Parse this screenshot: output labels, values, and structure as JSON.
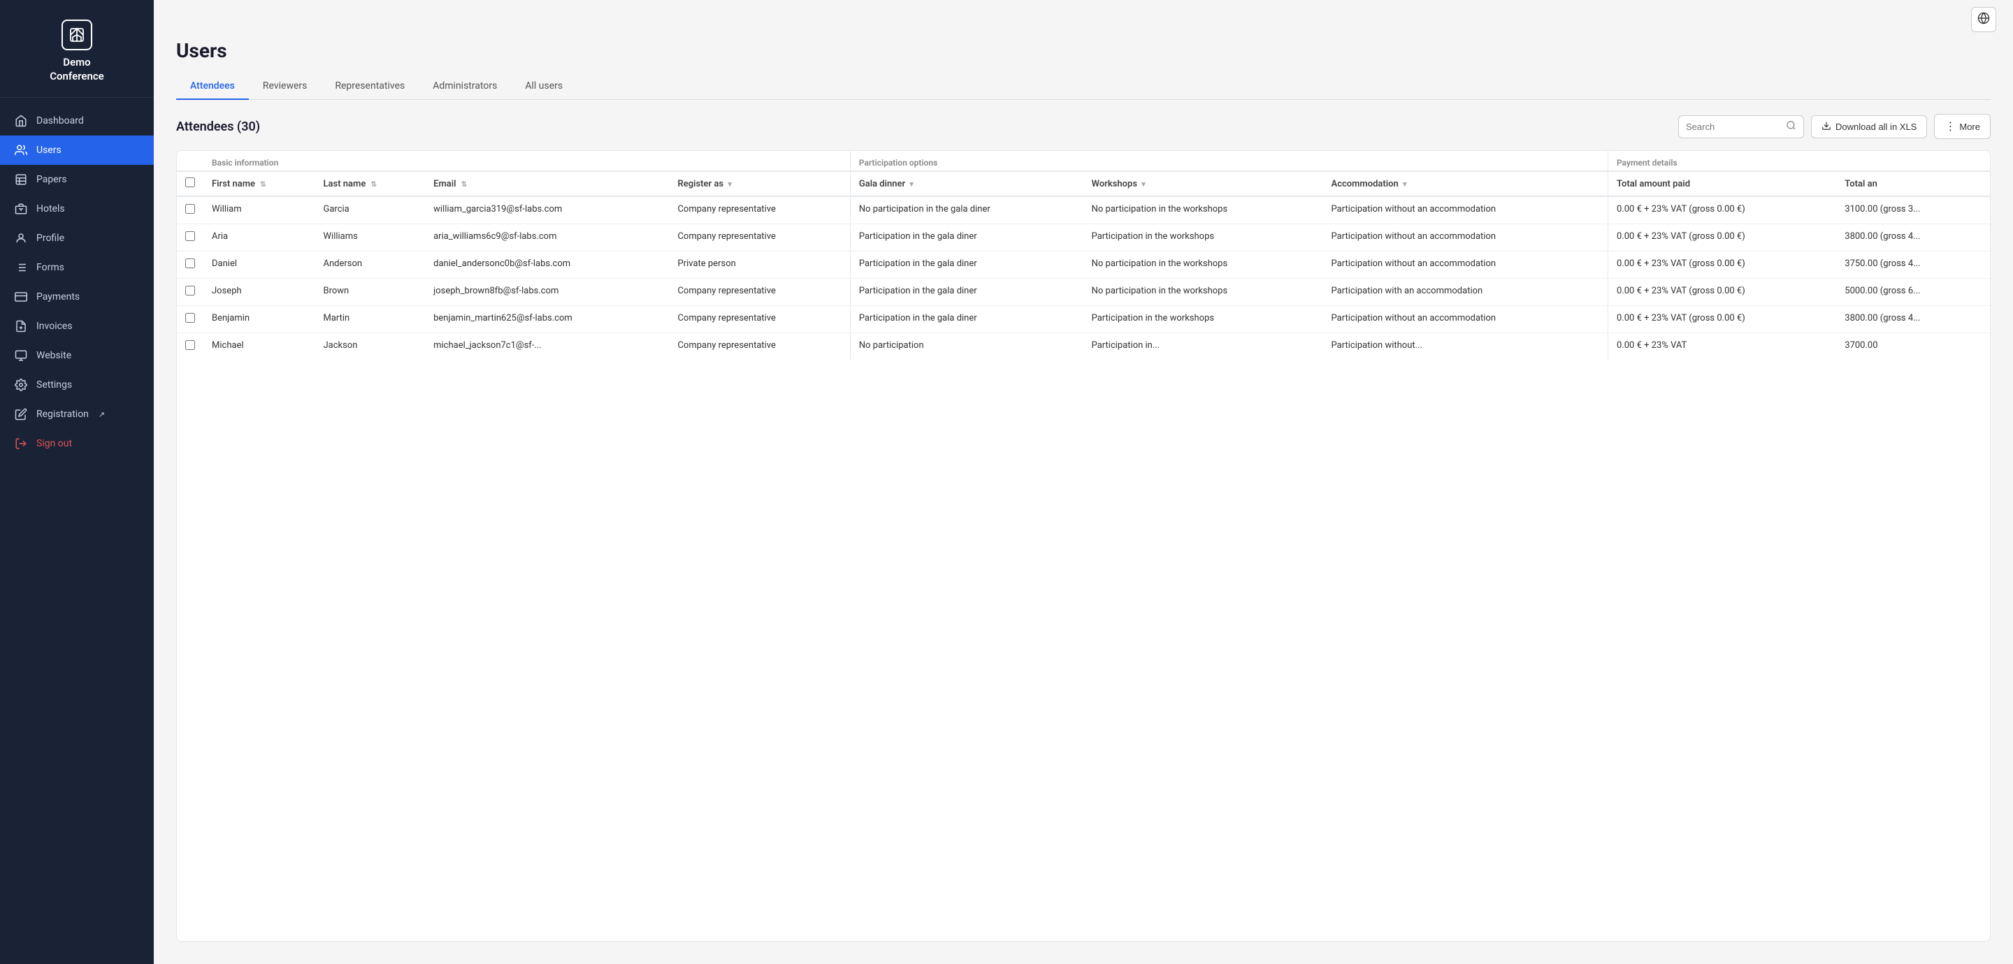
{
  "sidebar": {
    "logo": {
      "title": "Demo\nConference"
    },
    "nav_items": [
      {
        "id": "dashboard",
        "label": "Dashboard",
        "icon": "home-icon",
        "active": false
      },
      {
        "id": "users",
        "label": "Users",
        "icon": "users-icon",
        "active": true
      },
      {
        "id": "papers",
        "label": "Papers",
        "icon": "papers-icon",
        "active": false
      },
      {
        "id": "hotels",
        "label": "Hotels",
        "icon": "hotels-icon",
        "active": false
      },
      {
        "id": "profile",
        "label": "Profile",
        "icon": "profile-icon",
        "active": false
      },
      {
        "id": "forms",
        "label": "Forms",
        "icon": "forms-icon",
        "active": false
      },
      {
        "id": "payments",
        "label": "Payments",
        "icon": "payments-icon",
        "active": false
      },
      {
        "id": "invoices",
        "label": "Invoices",
        "icon": "invoices-icon",
        "active": false
      },
      {
        "id": "website",
        "label": "Website",
        "icon": "website-icon",
        "active": false
      },
      {
        "id": "settings",
        "label": "Settings",
        "icon": "settings-icon",
        "active": false
      },
      {
        "id": "registration",
        "label": "Registration",
        "icon": "registration-icon",
        "active": false
      }
    ],
    "sign_out_label": "Sign out"
  },
  "page": {
    "title": "Users",
    "tabs": [
      {
        "id": "attendees",
        "label": "Attendees",
        "active": true
      },
      {
        "id": "reviewers",
        "label": "Reviewers",
        "active": false
      },
      {
        "id": "representatives",
        "label": "Representatives",
        "active": false
      },
      {
        "id": "administrators",
        "label": "Administrators",
        "active": false
      },
      {
        "id": "all_users",
        "label": "All users",
        "active": false
      }
    ],
    "table_title": "Attendees (30)",
    "search_placeholder": "Search",
    "download_label": "Download all in XLS",
    "more_label": "More",
    "column_groups": [
      {
        "id": "basic",
        "label": "Basic information",
        "colspan": 4
      },
      {
        "id": "participation",
        "label": "Participation options",
        "colspan": 3
      },
      {
        "id": "payment",
        "label": "Payment details",
        "colspan": 2
      }
    ],
    "columns": [
      {
        "id": "firstname",
        "label": "First name"
      },
      {
        "id": "lastname",
        "label": "Last name"
      },
      {
        "id": "email",
        "label": "Email"
      },
      {
        "id": "register_as",
        "label": "Register as"
      },
      {
        "id": "gala_dinner",
        "label": "Gala dinner"
      },
      {
        "id": "workshops",
        "label": "Workshops"
      },
      {
        "id": "accommodation",
        "label": "Accommodation"
      },
      {
        "id": "total_amount_paid",
        "label": "Total amount paid"
      },
      {
        "id": "total_an",
        "label": "Total an"
      }
    ],
    "rows": [
      {
        "id": 1,
        "firstname": "William",
        "lastname": "Garcia",
        "email": "william_garcia319@sf-labs.com",
        "register_as": "Company representative",
        "gala_dinner": "No participation in the gala diner",
        "workshops": "No participation in the workshops",
        "accommodation": "Participation without an accommodation",
        "total_amount_paid": "0.00 € + 23% VAT (gross 0.00 €)",
        "total_an": "3100.00 (gross 3..."
      },
      {
        "id": 2,
        "firstname": "Aria",
        "lastname": "Williams",
        "email": "aria_williams6c9@sf-labs.com",
        "register_as": "Company representative",
        "gala_dinner": "Participation in the gala diner",
        "workshops": "Participation in the workshops",
        "accommodation": "Participation without an accommodation",
        "total_amount_paid": "0.00 € + 23% VAT (gross 0.00 €)",
        "total_an": "3800.00 (gross 4..."
      },
      {
        "id": 3,
        "firstname": "Daniel",
        "lastname": "Anderson",
        "email": "daniel_andersonc0b@sf-labs.com",
        "register_as": "Private person",
        "gala_dinner": "Participation in the gala diner",
        "workshops": "No participation in the workshops",
        "accommodation": "Participation without an accommodation",
        "total_amount_paid": "0.00 € + 23% VAT (gross 0.00 €)",
        "total_an": "3750.00 (gross 4..."
      },
      {
        "id": 4,
        "firstname": "Joseph",
        "lastname": "Brown",
        "email": "joseph_brown8fb@sf-labs.com",
        "register_as": "Company representative",
        "gala_dinner": "Participation in the gala diner",
        "workshops": "No participation in the workshops",
        "accommodation": "Participation with an accommodation",
        "total_amount_paid": "0.00 € + 23% VAT (gross 0.00 €)",
        "total_an": "5000.00 (gross 6..."
      },
      {
        "id": 5,
        "firstname": "Benjamin",
        "lastname": "Martin",
        "email": "benjamin_martin625@sf-labs.com",
        "register_as": "Company representative",
        "gala_dinner": "Participation in the gala diner",
        "workshops": "Participation in the workshops",
        "accommodation": "Participation without an accommodation",
        "total_amount_paid": "0.00 € + 23% VAT (gross 0.00 €)",
        "total_an": "3800.00 (gross 4..."
      },
      {
        "id": 6,
        "firstname": "Michael",
        "lastname": "Jackson",
        "email": "michael_jackson7c1@sf-...",
        "register_as": "Company representative",
        "gala_dinner": "No participation",
        "workshops": "Participation in...",
        "accommodation": "Participation without...",
        "total_amount_paid": "0.00 € + 23% VAT",
        "total_an": "3700.00"
      }
    ]
  }
}
